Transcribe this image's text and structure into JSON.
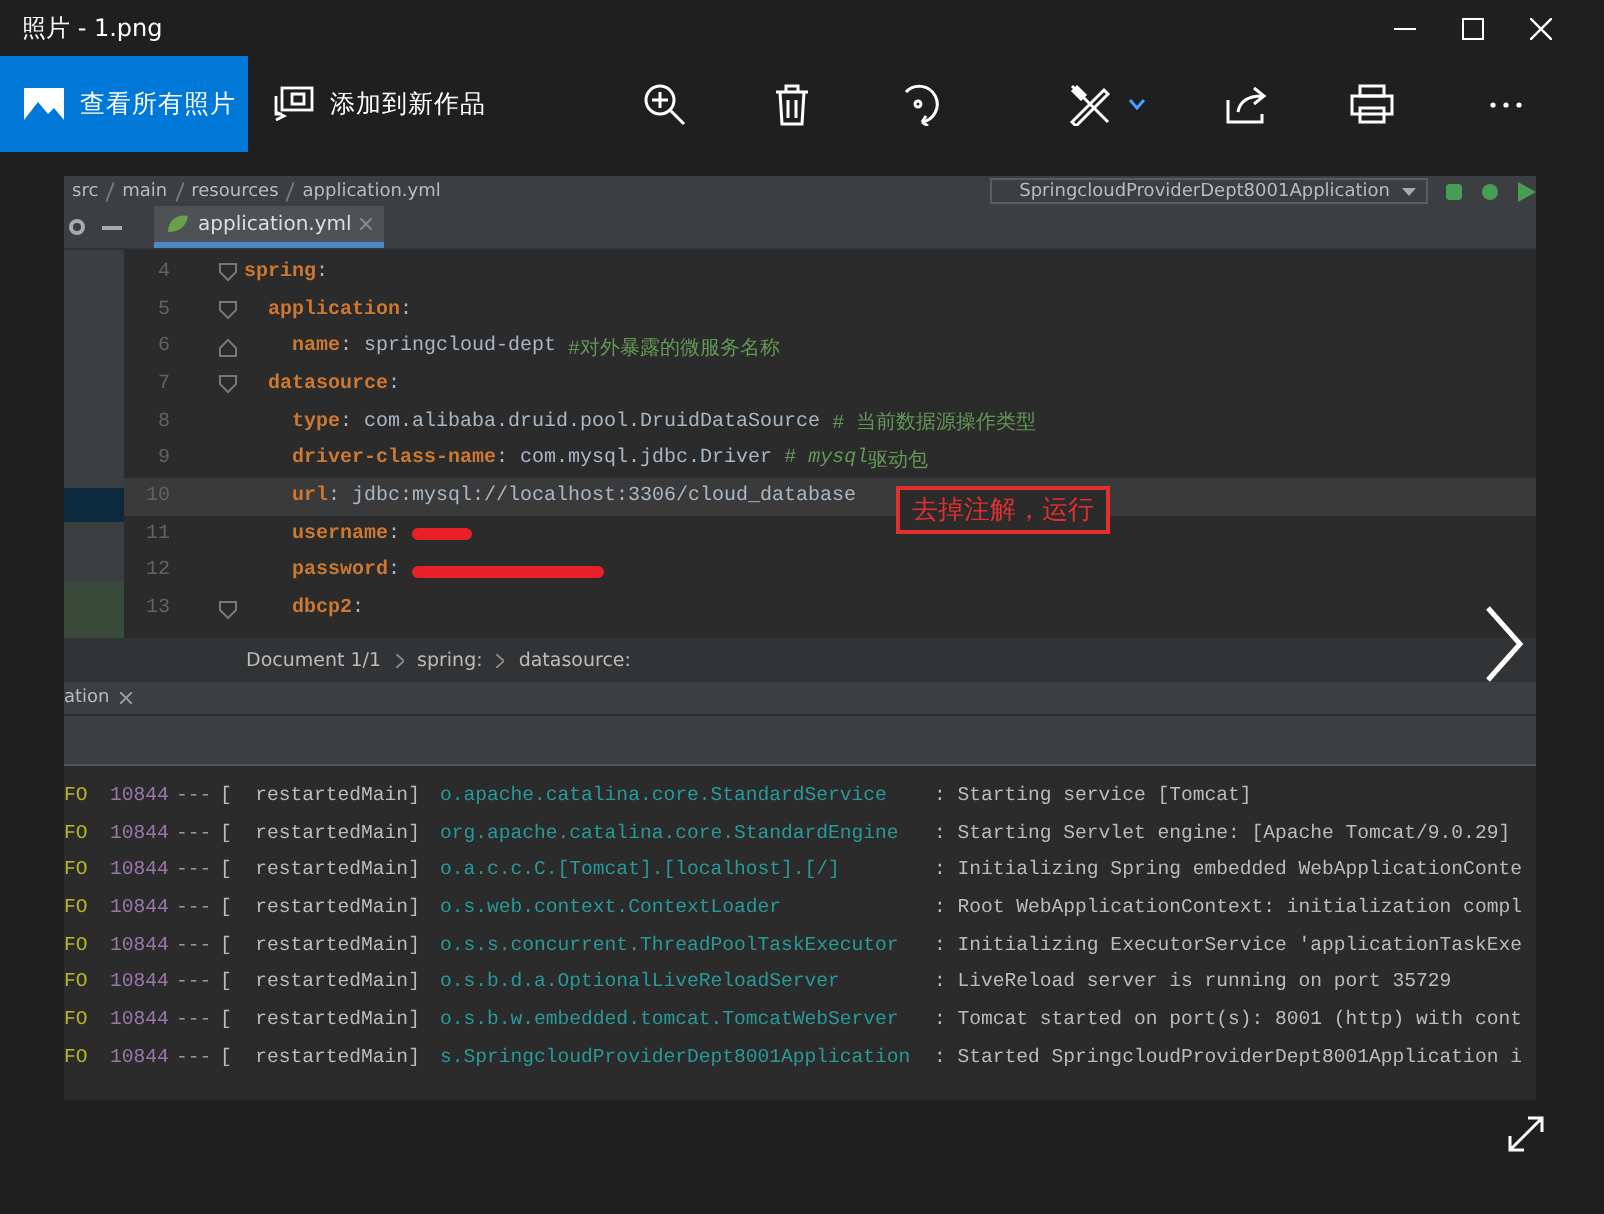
{
  "window": {
    "title": "照片 - 1.png"
  },
  "toolbar": {
    "buttons": [
      {
        "kind": "primary",
        "label": "查看所有照片"
      },
      {
        "kind": "plain",
        "label": "添加到新作品"
      }
    ]
  },
  "ide": {
    "path": [
      "src",
      "main",
      "resources",
      "application.yml"
    ],
    "run_config": "SpringcloudProviderDept8001Application",
    "tabs": [
      {
        "label": "application.yml",
        "selected": true
      }
    ],
    "code_lines": [
      {
        "number": "4",
        "fold_start": true,
        "fold_end": false,
        "current": false,
        "tokens": [
          {
            "kind": "key",
            "text": "spring"
          },
          {
            "kind": "plain",
            "text": ":"
          }
        ]
      },
      {
        "number": "5",
        "fold_start": true,
        "fold_end": false,
        "current": false,
        "tokens": [
          {
            "kind": "key",
            "text": "  application"
          },
          {
            "kind": "plain",
            "text": ":"
          }
        ]
      },
      {
        "number": "6",
        "fold_start": false,
        "fold_end": true,
        "current": false,
        "tokens": [
          {
            "kind": "key",
            "text": "    name"
          },
          {
            "kind": "plain",
            "text": ": springcloud-dept "
          },
          {
            "kind": "comment",
            "text": "#对外暴露的微服务名称"
          }
        ]
      },
      {
        "number": "7",
        "fold_start": true,
        "fold_end": false,
        "current": false,
        "tokens": [
          {
            "kind": "key",
            "text": "  datasource"
          },
          {
            "kind": "plain",
            "text": ":"
          }
        ]
      },
      {
        "number": "8",
        "fold_start": false,
        "fold_end": false,
        "current": false,
        "tokens": [
          {
            "kind": "key",
            "text": "    type"
          },
          {
            "kind": "plain",
            "text": ": com.alibaba.druid.pool.DruidDataSource "
          },
          {
            "kind": "comment",
            "text": "# 当前数据源操作类型"
          }
        ]
      },
      {
        "number": "9",
        "fold_start": false,
        "fold_end": false,
        "current": false,
        "tokens": [
          {
            "kind": "key",
            "text": "    driver-class-name"
          },
          {
            "kind": "plain",
            "text": ": com.mysql.jdbc.Driver "
          },
          {
            "kind": "comment",
            "text": "# "
          },
          {
            "kind": "comment-italic",
            "text": "mysql"
          },
          {
            "kind": "comment",
            "text": "驱动包"
          }
        ]
      },
      {
        "number": "10",
        "fold_start": false,
        "fold_end": false,
        "current": true,
        "tokens": [
          {
            "kind": "key",
            "text": "    url"
          },
          {
            "kind": "plain",
            "text": ": jdbc:mysql://localhost:3306/cloud_database"
          }
        ]
      },
      {
        "number": "11",
        "fold_start": false,
        "fold_end": false,
        "current": false,
        "tokens": [
          {
            "kind": "key",
            "text": "    username"
          },
          {
            "kind": "plain",
            "text": ": "
          },
          {
            "kind": "redaction-short"
          }
        ]
      },
      {
        "number": "12",
        "fold_start": false,
        "fold_end": false,
        "current": false,
        "tokens": [
          {
            "kind": "key",
            "text": "    password"
          },
          {
            "kind": "plain",
            "text": ": "
          },
          {
            "kind": "redaction-long"
          }
        ]
      },
      {
        "number": "13",
        "fold_start": true,
        "fold_end": false,
        "current": false,
        "tokens": [
          {
            "kind": "key",
            "text": "    dbcp2"
          },
          {
            "kind": "plain",
            "text": ":"
          }
        ]
      }
    ],
    "annotation": "去掉注解，运行",
    "breadcrumbs": [
      "Document 1/1",
      "spring:",
      "datasource:"
    ],
    "tool_tab": "ation",
    "console": [
      {
        "level": "FO",
        "pid": "10844",
        "sep": "---",
        "thread": "[  restartedMain]",
        "logger": "o.apache.catalina.core.StandardService",
        "message": ": Starting service [Tomcat]"
      },
      {
        "level": "FO",
        "pid": "10844",
        "sep": "---",
        "thread": "[  restartedMain]",
        "logger": "org.apache.catalina.core.StandardEngine",
        "message": ": Starting Servlet engine: [Apache Tomcat/9.0.29]"
      },
      {
        "level": "FO",
        "pid": "10844",
        "sep": "---",
        "thread": "[  restartedMain]",
        "logger": "o.a.c.c.C.[Tomcat].[localhost].[/]",
        "message": ": Initializing Spring embedded WebApplicationConte"
      },
      {
        "level": "FO",
        "pid": "10844",
        "sep": "---",
        "thread": "[  restartedMain]",
        "logger": "o.s.web.context.ContextLoader",
        "message": ": Root WebApplicationContext: initialization compl"
      },
      {
        "level": "FO",
        "pid": "10844",
        "sep": "---",
        "thread": "[  restartedMain]",
        "logger": "o.s.s.concurrent.ThreadPoolTaskExecutor",
        "message": ": Initializing ExecutorService 'applicationTaskExe"
      },
      {
        "level": "FO",
        "pid": "10844",
        "sep": "---",
        "thread": "[  restartedMain]",
        "logger": "o.s.b.d.a.OptionalLiveReloadServer",
        "message": ": LiveReload server is running on port 35729"
      },
      {
        "level": "FO",
        "pid": "10844",
        "sep": "---",
        "thread": "[  restartedMain]",
        "logger": "o.s.b.w.embedded.tomcat.TomcatWebServer",
        "message": ": Tomcat started on port(s): 8001 (http) with cont"
      },
      {
        "level": "FO",
        "pid": "10844",
        "sep": "---",
        "thread": "[  restartedMain]",
        "logger": "s.SpringcloudProviderDept8001Application",
        "message": ": Started SpringcloudProviderDept8001Application i"
      }
    ]
  }
}
